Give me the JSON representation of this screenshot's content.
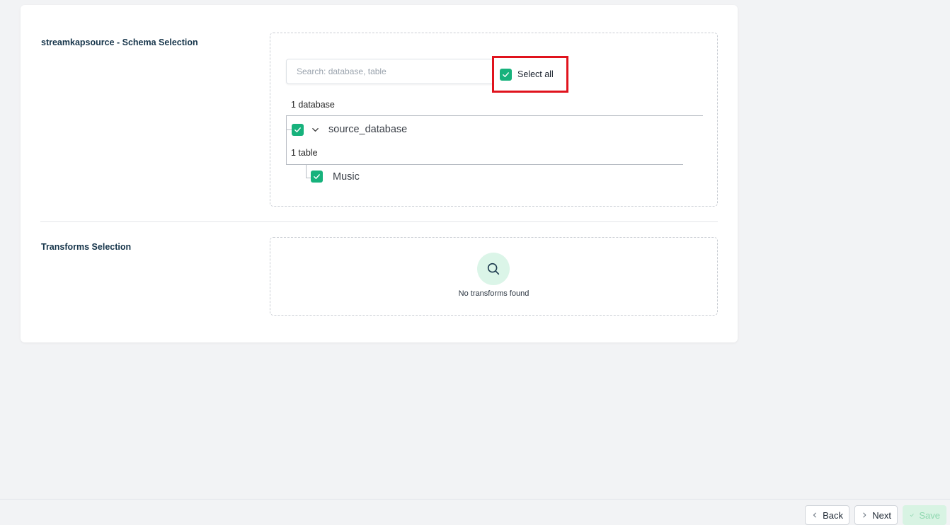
{
  "schema_section": {
    "title": "streamkapsource - Schema Selection",
    "search_placeholder": "Search: database, table",
    "select_all_label": "Select all",
    "database_count": "1 database",
    "database_name": "source_database",
    "table_count": "1 table",
    "table_name": "Music"
  },
  "transforms_section": {
    "title": "Transforms Selection",
    "empty_text": "No transforms found"
  },
  "footer": {
    "back_label": "Back",
    "next_label": "Next",
    "save_label": "Save"
  },
  "colors": {
    "accent": "#17b27c",
    "highlight_border": "#e0131d"
  },
  "icons": [
    "check-icon",
    "chevron-down-icon",
    "search-icon",
    "chevron-left-icon",
    "chevron-right-icon"
  ]
}
